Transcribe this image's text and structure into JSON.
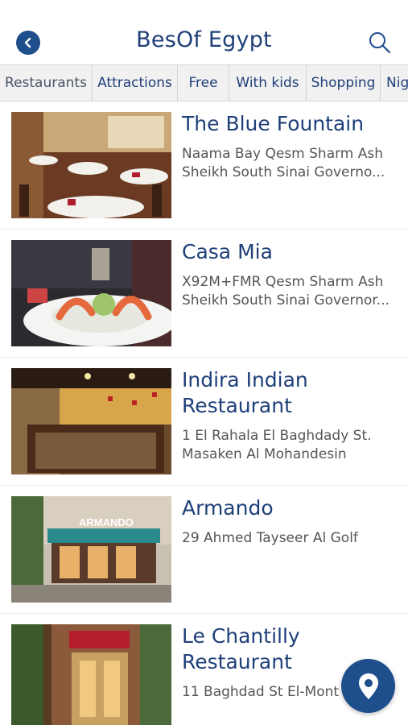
{
  "app": {
    "title": "BesOf Egypt"
  },
  "tabs": [
    {
      "label": "Restaurants"
    },
    {
      "label": "Attractions"
    },
    {
      "label": "Free"
    },
    {
      "label": "With kids"
    },
    {
      "label": "Shopping"
    },
    {
      "label": "Nig"
    }
  ],
  "places": [
    {
      "name": "The Blue Fountain",
      "address_line1": "Naama Bay Qesm Sharm Ash",
      "address_line2": "Sheikh South Sinai Governo..."
    },
    {
      "name": "Casa Mia",
      "address_line1": "X92M+FMR Qesm Sharm Ash",
      "address_line2": "Sheikh South Sinai Governor..."
    },
    {
      "name_line1": "Indira Indian",
      "name_line2": "Restaurant",
      "address_line1": "1 El Rahala El Baghdady St.",
      "address_line2": "Masaken Al Mohandesin"
    },
    {
      "name": "Armando",
      "address_line1": "29 Ahmed Tayseer Al Golf",
      "sign_text": "ARMANDO"
    },
    {
      "name_line1": "Le Chantilly",
      "name_line2": "Restaurant",
      "address_line1": "11 Baghdad St El-Mont"
    }
  ],
  "colors": {
    "brand": "#1f4e8c",
    "title": "#1f3f79"
  },
  "icons": {
    "back": "chevron-left-icon",
    "search": "search-icon",
    "map": "map-pin-icon"
  }
}
